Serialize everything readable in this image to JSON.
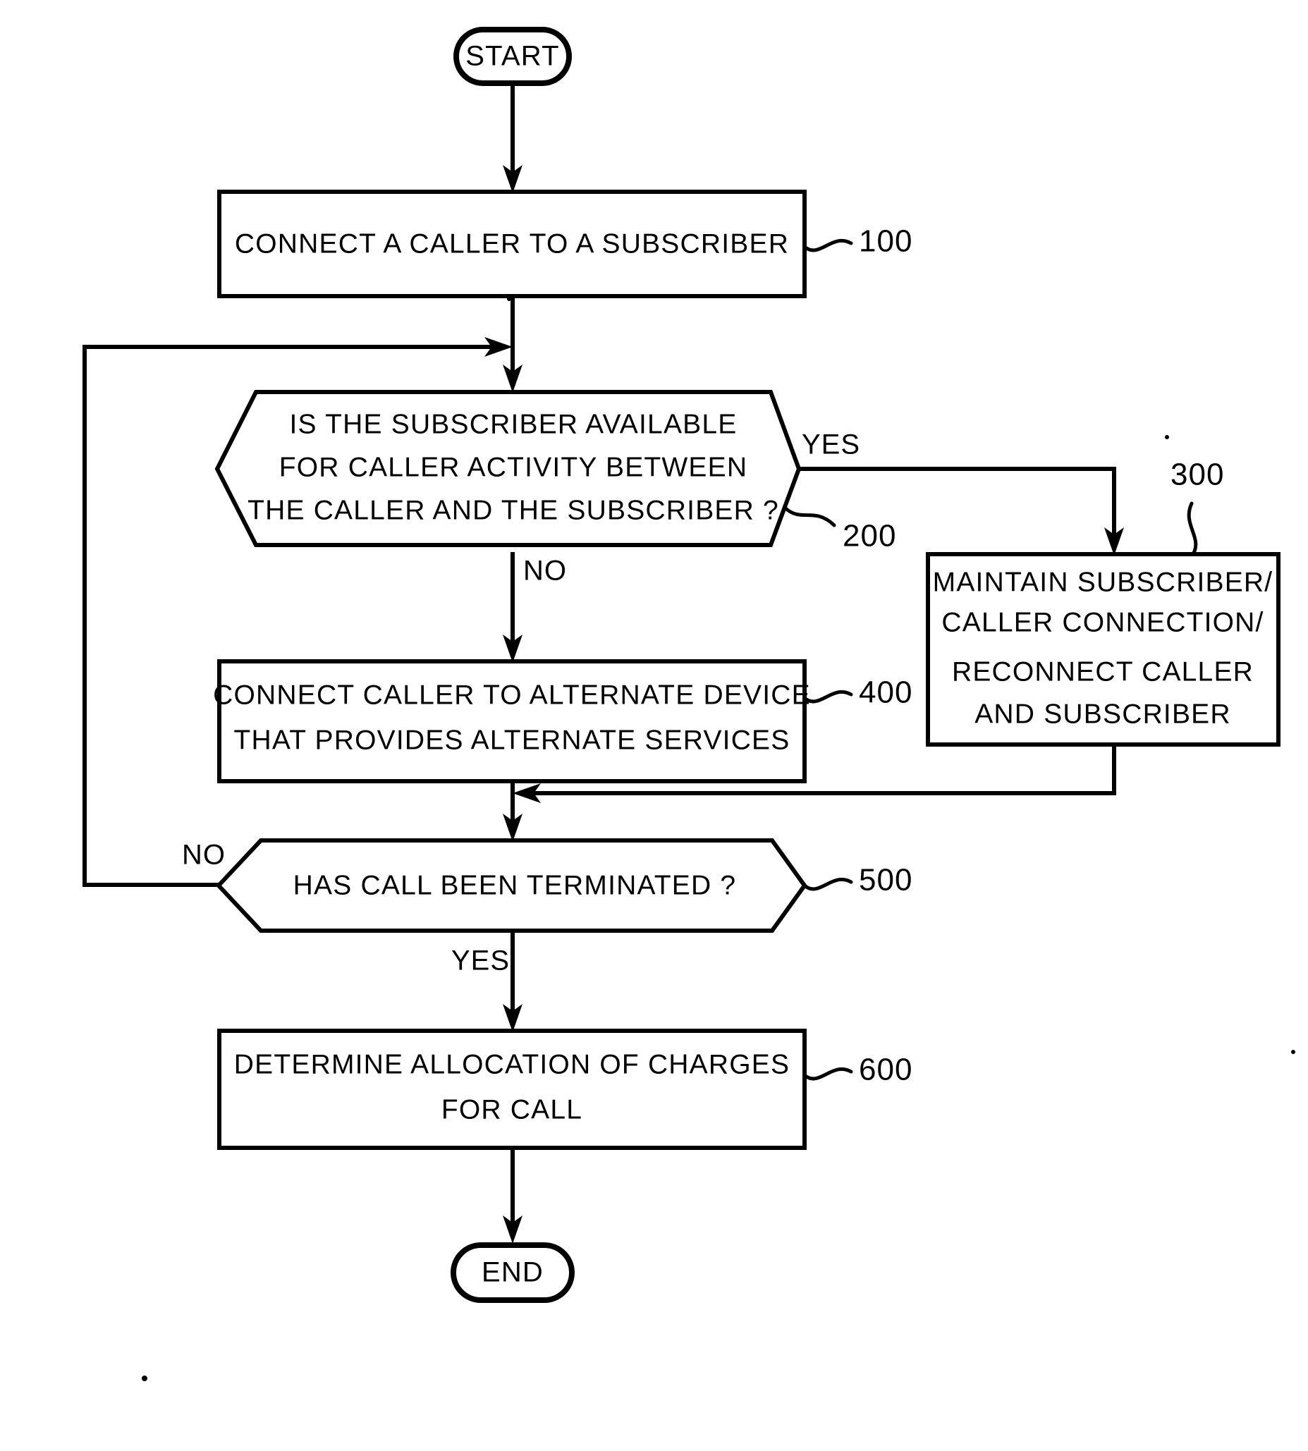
{
  "figure": {
    "type": "patent-flowchart",
    "background_color": "#ffffff",
    "line_color": "#000000"
  },
  "nodes": {
    "start": {
      "label": "START",
      "shape": "terminator"
    },
    "step100": {
      "label": "CONNECT A CALLER TO A SUBSCRIBER",
      "shape": "process",
      "ref": "100"
    },
    "step200": {
      "line1": "IS THE SUBSCRIBER AVAILABLE",
      "line2": "FOR CALLER ACTIVITY BETWEEN",
      "line3": "THE CALLER AND THE SUBSCRIBER ?",
      "shape": "decision",
      "ref": "200"
    },
    "step300": {
      "line1": "MAINTAIN SUBSCRIBER/",
      "line2": "CALLER CONNECTION/",
      "line3": "RECONNECT CALLER",
      "line4": "AND SUBSCRIBER",
      "shape": "process",
      "ref": "300"
    },
    "step400": {
      "line1": "CONNECT CALLER TO ALTERNATE DEVICE",
      "line2": "THAT PROVIDES ALTERNATE SERVICES",
      "shape": "process",
      "ref": "400"
    },
    "step500": {
      "label": "HAS CALL BEEN TERMINATED ?",
      "shape": "decision",
      "ref": "500"
    },
    "step600": {
      "line1": "DETERMINE ALLOCATION OF CHARGES",
      "line2": "FOR CALL",
      "shape": "process",
      "ref": "600"
    },
    "end": {
      "label": "END",
      "shape": "terminator"
    }
  },
  "edge_labels": {
    "decision200_yes": "YES",
    "decision200_no": "NO",
    "decision500_no": "NO",
    "decision500_yes": "YES"
  }
}
